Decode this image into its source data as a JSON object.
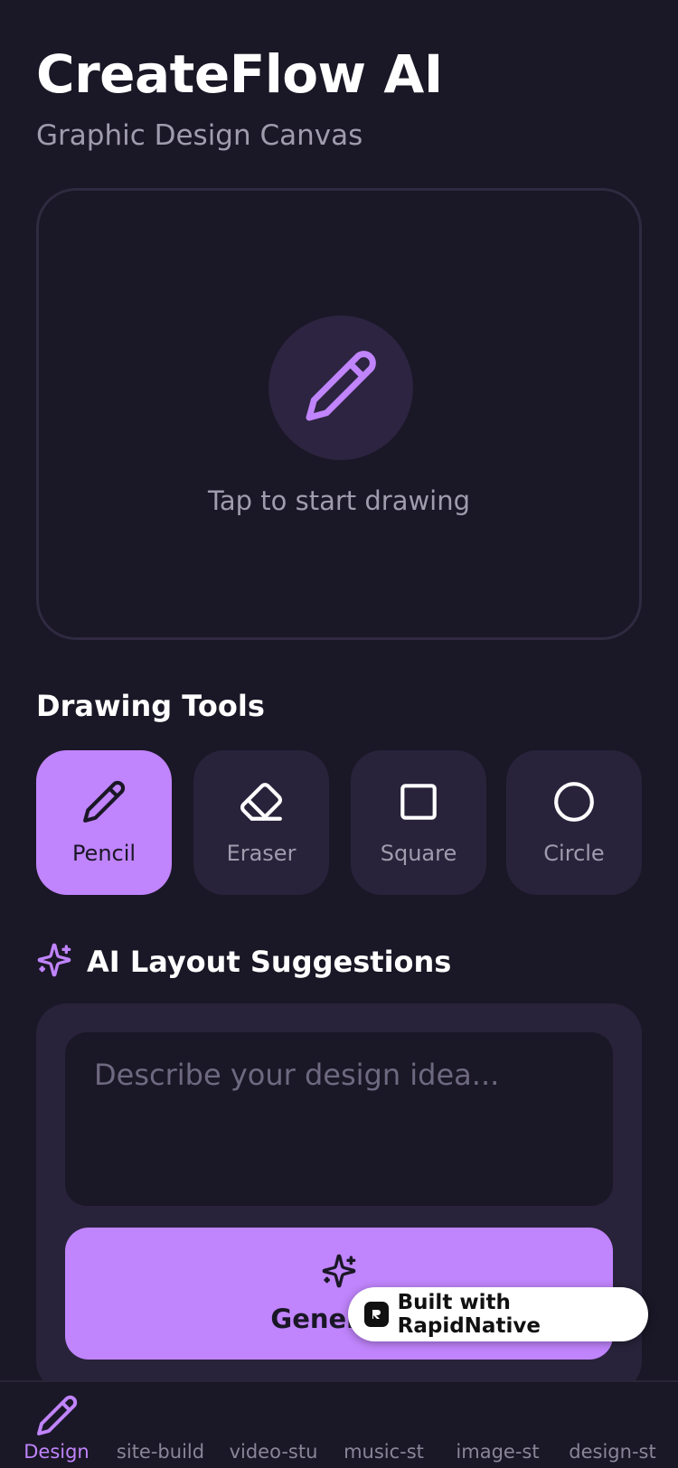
{
  "header": {
    "title": "CreateFlow AI",
    "subtitle": "Graphic Design Canvas"
  },
  "canvas": {
    "hint": "Tap to start drawing",
    "icon": "pencil-icon"
  },
  "tools": {
    "title": "Drawing Tools",
    "items": [
      {
        "label": "Pencil",
        "icon": "pencil-icon",
        "active": true
      },
      {
        "label": "Eraser",
        "icon": "eraser-icon",
        "active": false
      },
      {
        "label": "Square",
        "icon": "square-icon",
        "active": false
      },
      {
        "label": "Circle",
        "icon": "circle-icon",
        "active": false
      }
    ]
  },
  "ai": {
    "title": "AI Layout Suggestions",
    "icon": "sparkles-icon",
    "prompt_placeholder": "Describe your design idea...",
    "prompt_value": "",
    "generate_label": "Generate"
  },
  "badge": {
    "text": "Built with RapidNative"
  },
  "tabbar": {
    "tabs": [
      {
        "label": "Design",
        "active": true
      },
      {
        "label": "site-build",
        "active": false
      },
      {
        "label": "video-stu",
        "active": false
      },
      {
        "label": "music-st",
        "active": false
      },
      {
        "label": "image-st",
        "active": false
      },
      {
        "label": "design-st",
        "active": false
      }
    ]
  },
  "colors": {
    "background": "#1a1726",
    "accent": "#c084fc",
    "card": "#28233a",
    "muted_text": "#a09cae"
  }
}
